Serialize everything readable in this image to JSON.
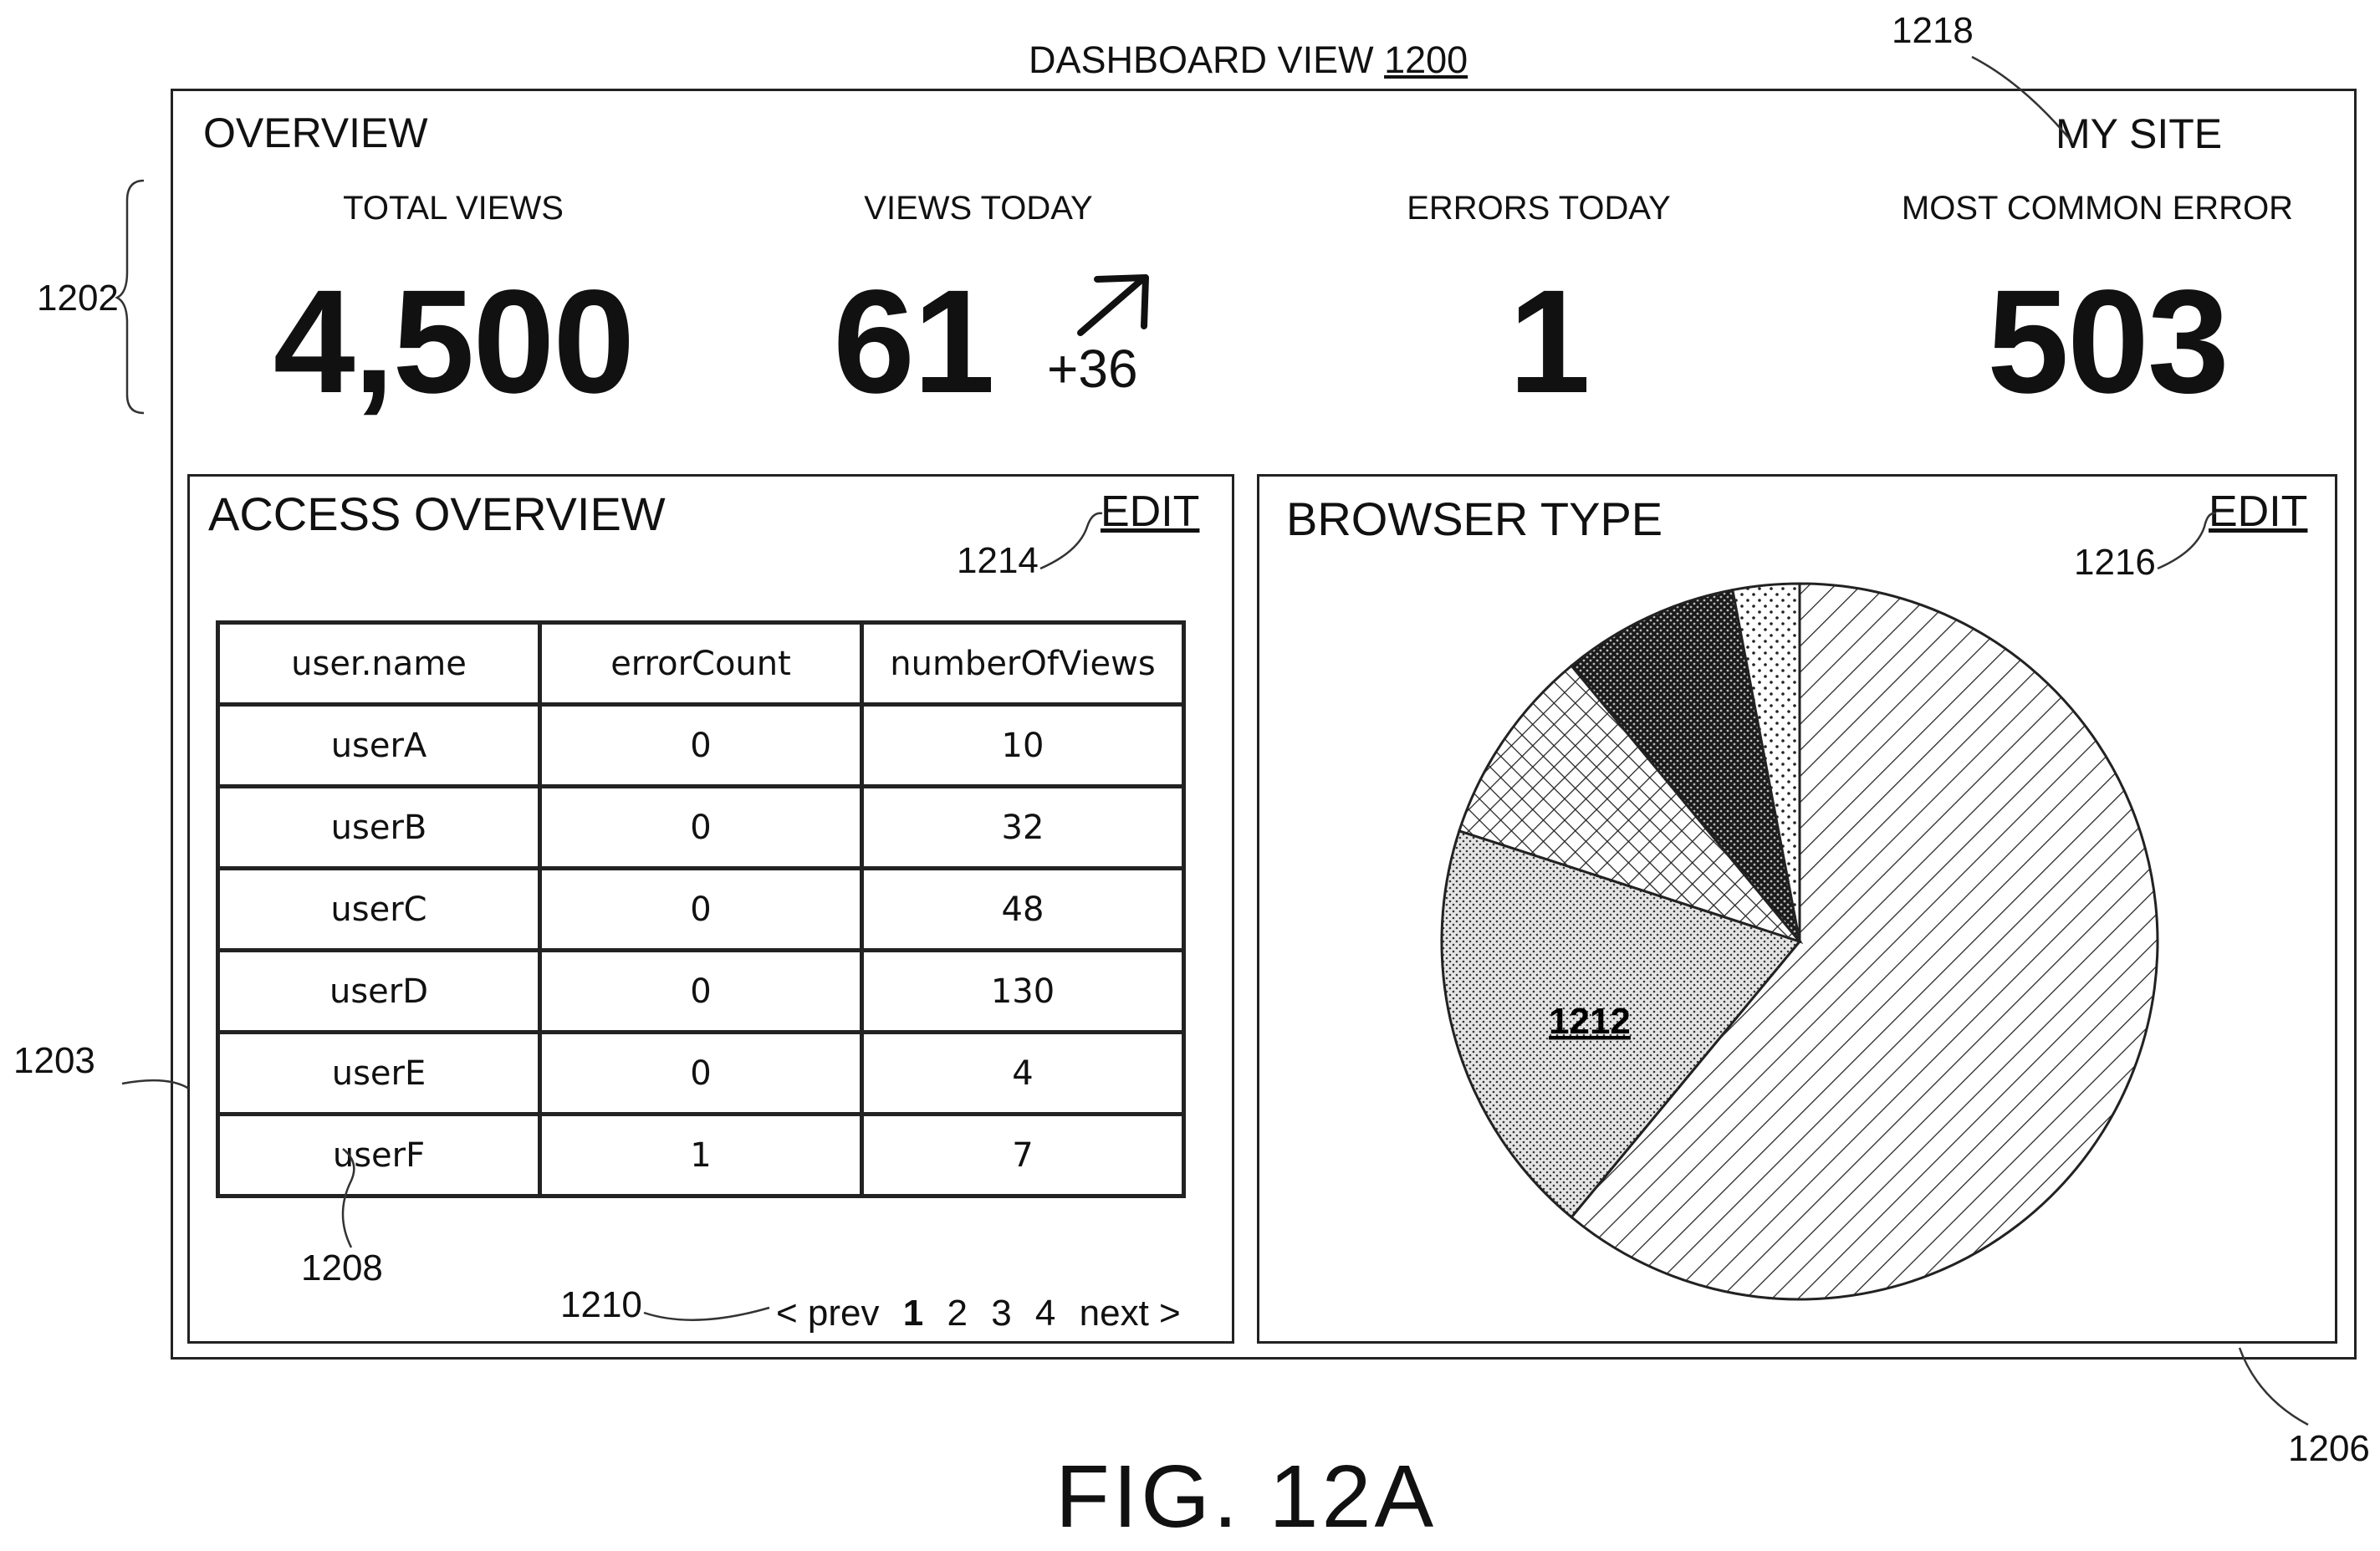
{
  "header": {
    "title": "DASHBOARD VIEW ",
    "title_ref": "1200"
  },
  "overview": {
    "label": "OVERVIEW",
    "site_label": "MY SITE",
    "stats": [
      {
        "label": "TOTAL VIEWS",
        "value": "4,500"
      },
      {
        "label": "VIEWS TODAY",
        "value": "61",
        "delta": "+36",
        "trend": "up-right-arrow-icon"
      },
      {
        "label": "ERRORS TODAY",
        "value": "1"
      },
      {
        "label": "MOST COMMON ERROR",
        "value": "503"
      }
    ]
  },
  "access_panel": {
    "title": "ACCESS OVERVIEW",
    "edit_label": "EDIT",
    "columns": [
      "user.name",
      "errorCount",
      "numberOfViews"
    ],
    "rows": [
      [
        "userA",
        "0",
        "10"
      ],
      [
        "userB",
        "0",
        "32"
      ],
      [
        "userC",
        "0",
        "48"
      ],
      [
        "userD",
        "0",
        "130"
      ],
      [
        "userE",
        "0",
        "4"
      ],
      [
        "userF",
        "1",
        "7"
      ]
    ],
    "pager": {
      "prev": "< prev",
      "pages": [
        "1",
        "2",
        "3",
        "4"
      ],
      "current": "1",
      "next": "next >"
    }
  },
  "browser_panel": {
    "title": "BROWSER TYPE",
    "edit_label": "EDIT",
    "slice_label": "1212",
    "chart_data": {
      "type": "pie",
      "slices": [
        {
          "value": 0.61,
          "pattern": "diagonal-hatch"
        },
        {
          "value": 0.19,
          "pattern": "dense-dots"
        },
        {
          "value": 0.09,
          "pattern": "crosshatch"
        },
        {
          "value": 0.08,
          "pattern": "dark-dots"
        },
        {
          "value": 0.03,
          "pattern": "sparse-dots"
        }
      ]
    }
  },
  "reference_numerals": {
    "r1202": "1202",
    "r1203": "1203",
    "r1206": "1206",
    "r1208": "1208",
    "r1210": "1210",
    "r1214": "1214",
    "r1216": "1216",
    "r1218": "1218"
  },
  "figure_caption": "FIG. 12A"
}
